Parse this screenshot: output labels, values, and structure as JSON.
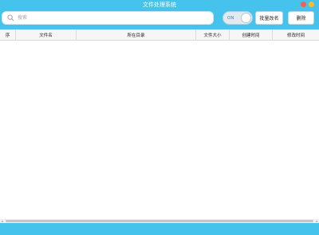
{
  "window": {
    "title": "文件处理系统"
  },
  "search": {
    "placeholder": "搜索",
    "value": ""
  },
  "toggle": {
    "label": "ON",
    "state": "on"
  },
  "toolbar": {
    "rename_label": "批量改名",
    "delete_label": "删除"
  },
  "table": {
    "columns": [
      "序",
      "文件名",
      "所在目录",
      "文件大小",
      "创建时间",
      "修改时间"
    ],
    "rows": []
  },
  "colors": {
    "accent": "#45c3ec",
    "close": "#f45f56",
    "minimize": "#f6bd2f"
  },
  "icons": {
    "search": "search-icon",
    "close": "close-dot-icon",
    "minimize": "minimize-dot-icon"
  }
}
